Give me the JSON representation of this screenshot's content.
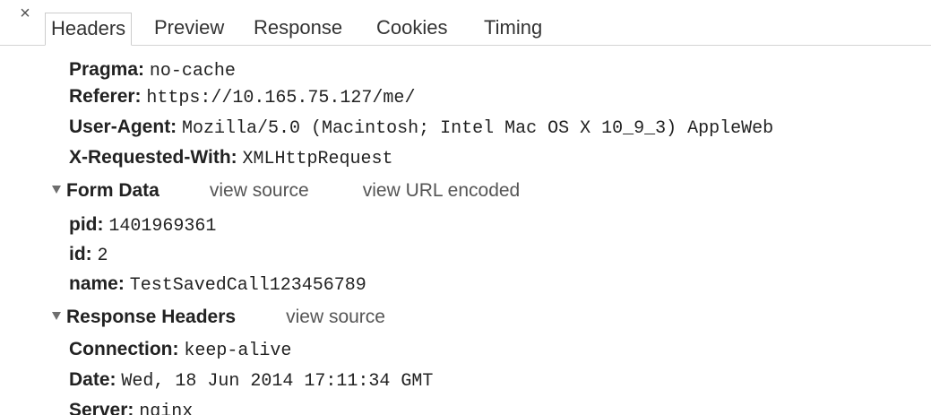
{
  "tabbar": {
    "close_glyph": "×",
    "tabs": [
      "Headers",
      "Preview",
      "Response",
      "Cookies",
      "Timing"
    ],
    "selected": "Headers"
  },
  "request_headers": [
    {
      "key": "Pragma:",
      "value": "no-cache"
    },
    {
      "key": "Referer:",
      "value": "https://10.165.75.127/me/"
    },
    {
      "key": "User-Agent:",
      "value": "Mozilla/5.0 (Macintosh; Intel Mac OS X 10_9_3) AppleWeb"
    },
    {
      "key": "X-Requested-With:",
      "value": "XMLHttpRequest"
    }
  ],
  "form_data": {
    "title": "Form Data",
    "view_source": "view source",
    "view_url_encoded": "view URL encoded",
    "fields": [
      {
        "key": "pid:",
        "value": "1401969361"
      },
      {
        "key": "id:",
        "value": "2"
      },
      {
        "key": "name:",
        "value": "TestSavedCall123456789"
      }
    ]
  },
  "response_headers": {
    "title": "Response Headers",
    "view_source": "view source",
    "fields": [
      {
        "key": "Connection:",
        "value": "keep-alive"
      },
      {
        "key": "Date:",
        "value": "Wed, 18 Jun 2014 17:11:34 GMT"
      },
      {
        "key": "Server:",
        "value": "nginx"
      }
    ]
  },
  "colors": {
    "border": "#cccccc",
    "link": "#555555",
    "triangle": "#6e6e6e"
  }
}
